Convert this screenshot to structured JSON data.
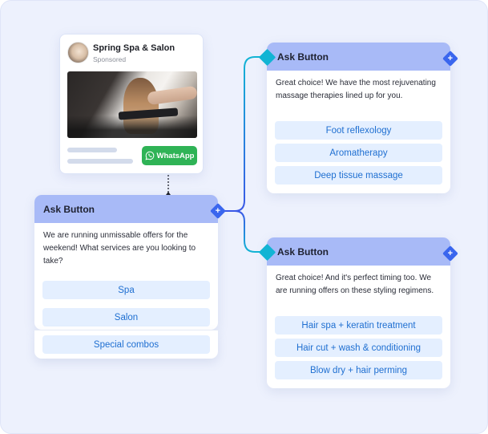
{
  "colors": {
    "canvas_bg": "#edf1fd",
    "node_header": "#a8baf7",
    "option_bg": "#e4efff",
    "option_text": "#1f6fd1",
    "whatsapp_green": "#2fb356",
    "port_plus": "#3a66ee",
    "port_in": "#12b4d4"
  },
  "ad": {
    "page_name": "Spring Spa & Salon",
    "sponsored_label": "Sponsored",
    "cta_label": "WhatsApp",
    "cta_icon": "whatsapp-icon",
    "avatar_icon": "avatar-image",
    "image_alt": "hair-straightening-photo"
  },
  "nodes": [
    {
      "title": "Ask Button",
      "message": "We are running unmissable offers for the weekend! What services are you looking to take?",
      "options": [
        "Spa",
        "Salon",
        "Special combos"
      ]
    },
    {
      "title": "Ask Button",
      "message": "Great choice! We have the most rejuvenating massage therapies lined up for you.",
      "options": [
        "Foot reflexology",
        "Aromatherapy",
        "Deep tissue massage"
      ]
    },
    {
      "title": "Ask Button",
      "message": "Great choice! And it's perfect timing too. We are running offers on these styling regimens.",
      "options": [
        "Hair spa + keratin treatment",
        "Hair cut + wash & conditioning",
        "Blow dry + hair perming"
      ]
    }
  ],
  "ports": {
    "plus_symbol": "+"
  }
}
